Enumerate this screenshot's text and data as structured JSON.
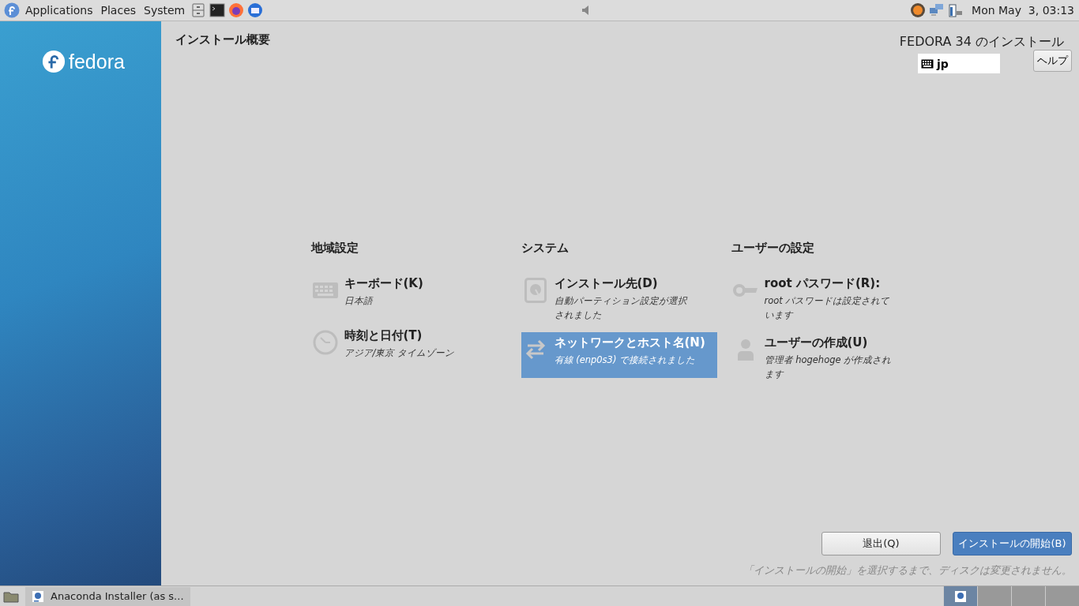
{
  "top_panel": {
    "menus": [
      "Applications",
      "Places",
      "System"
    ],
    "clock": "Mon May  3, 03:13"
  },
  "sidebar": {
    "logo_text": "fedora"
  },
  "header": {
    "title": "インストール概要",
    "product": "FEDORA 34 のインストール",
    "keyboard_layout": "jp",
    "help_button": "ヘルプ"
  },
  "categories": [
    {
      "title": "地域設定",
      "spokes": [
        {
          "kind": "keyboard",
          "title": "キーボード(K)",
          "status": "日本語",
          "selected": false
        },
        {
          "kind": "clock",
          "title": "時刻と日付(T)",
          "status": "アジア/東京 タイムゾーン",
          "selected": false
        }
      ]
    },
    {
      "title": "システム",
      "spokes": [
        {
          "kind": "disk",
          "title": "インストール先(D)",
          "status": "自動パーティション設定が選択されました",
          "selected": false
        },
        {
          "kind": "network",
          "title": "ネットワークとホスト名(N)",
          "status": "有線 (enp0s3) で接続されました",
          "selected": true
        }
      ]
    },
    {
      "title": "ユーザーの設定",
      "spokes": [
        {
          "kind": "key",
          "title": "root パスワード(R):",
          "status": "root パスワードは設定されています",
          "selected": false
        },
        {
          "kind": "user",
          "title": "ユーザーの作成(U)",
          "status": "管理者 hogehoge が作成されます",
          "selected": false
        }
      ]
    }
  ],
  "buttons": {
    "quit": "退出(Q)",
    "begin": "インストールの開始(B)"
  },
  "note": "「インストールの開始」を選択するまで、ディスクは変更されません。",
  "taskbar": {
    "window": "Anaconda Installer (as s...",
    "workspaces": [
      {
        "selected": true
      },
      {
        "selected": false
      },
      {
        "selected": false
      },
      {
        "selected": false
      }
    ]
  }
}
